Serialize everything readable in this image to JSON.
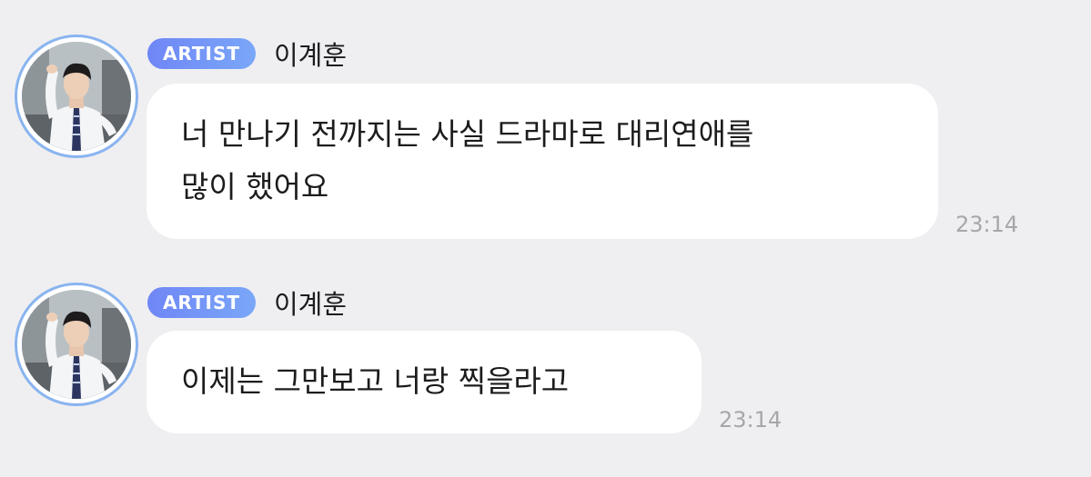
{
  "messages": [
    {
      "badge": "ARTIST",
      "sender": "이계훈",
      "text_line1": "너 만나기 전까지는 사실 드라마로 대리연애를",
      "text_line2": "많이 했어요",
      "time": "23:14"
    },
    {
      "badge": "ARTIST",
      "sender": "이계훈",
      "text_line1": "이제는 그만보고 너랑 찍을라고",
      "time": "23:14"
    }
  ],
  "colors": {
    "background": "#efeff1",
    "bubble": "#ffffff",
    "badge_gradient_start": "#6f86f6",
    "badge_gradient_end": "#7aa7f8",
    "avatar_ring": "#8ab4f0",
    "timestamp": "#a6a6ab"
  }
}
